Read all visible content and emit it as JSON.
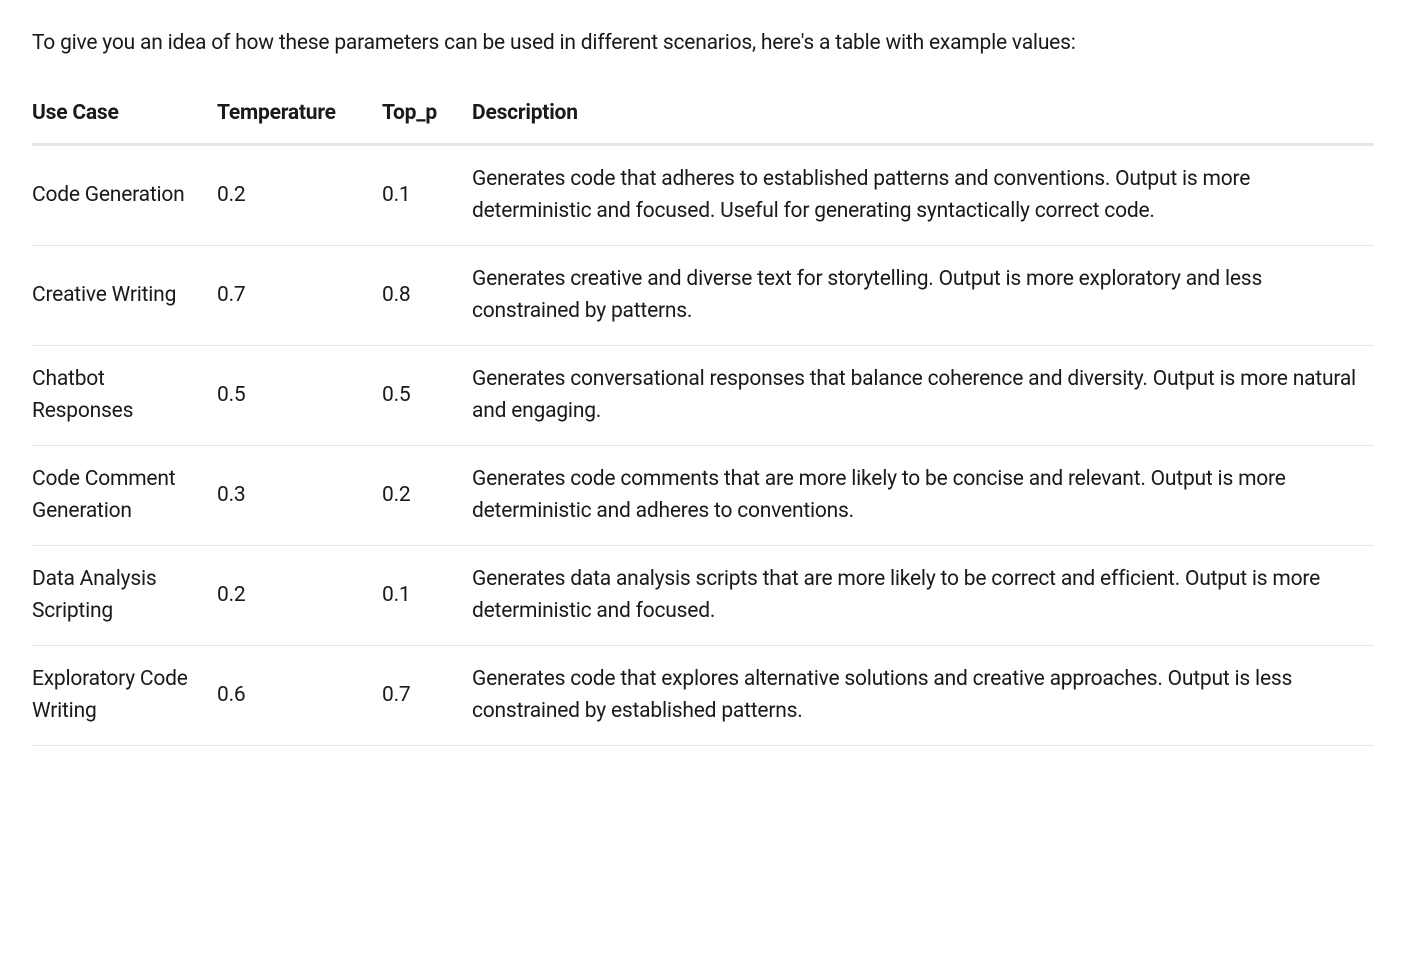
{
  "intro": "To give you an idea of how these parameters can be used in different scenarios, here's a table with example values:",
  "headers": {
    "usecase": "Use Case",
    "temperature": "Temperature",
    "top_p": "Top_p",
    "description": "Description"
  },
  "rows": [
    {
      "usecase": "Code Generation",
      "temperature": "0.2",
      "top_p": "0.1",
      "description": "Generates code that adheres to established patterns and conventions. Output is more deterministic and focused. Useful for generating syntactically correct code."
    },
    {
      "usecase": "Creative Writing",
      "temperature": "0.7",
      "top_p": "0.8",
      "description": "Generates creative and diverse text for storytelling. Output is more exploratory and less constrained by patterns."
    },
    {
      "usecase": "Chatbot Responses",
      "temperature": "0.5",
      "top_p": "0.5",
      "description": "Generates conversational responses that balance coherence and diversity. Output is more natural and engaging."
    },
    {
      "usecase": "Code Comment Generation",
      "temperature": "0.3",
      "top_p": "0.2",
      "description": "Generates code comments that are more likely to be concise and relevant. Output is more deterministic and adheres to conventions."
    },
    {
      "usecase": "Data Analysis Scripting",
      "temperature": "0.2",
      "top_p": "0.1",
      "description": "Generates data analysis scripts that are more likely to be correct and efficient. Output is more deterministic and focused."
    },
    {
      "usecase": "Exploratory Code Writing",
      "temperature": "0.6",
      "top_p": "0.7",
      "description": "Generates code that explores alternative solutions and creative approaches. Output is less constrained by established patterns."
    }
  ]
}
